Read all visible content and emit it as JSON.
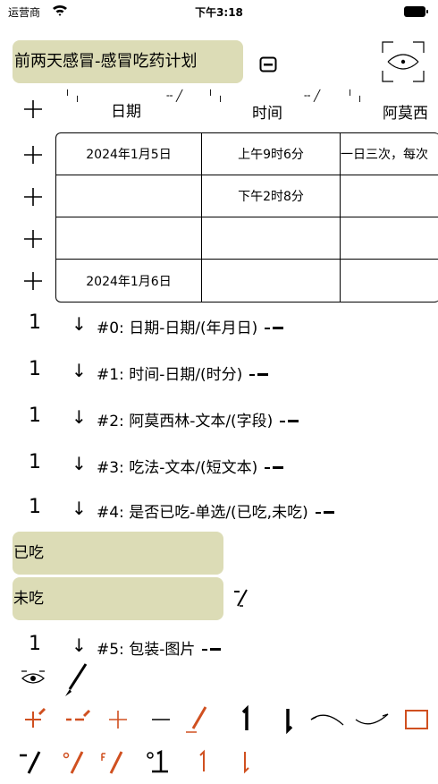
{
  "status_bar": {
    "carrier": "运营商",
    "time": "下午3:18"
  },
  "title": "前两天感冒-感冒吃药计划",
  "table": {
    "headers": [
      "日期",
      "时间",
      "阿莫西"
    ],
    "rows": [
      [
        "2024年1月5日",
        "上午9时6分",
        "一日三次，每次"
      ],
      [
        "",
        "下午2时8分",
        ""
      ],
      [
        "",
        "",
        ""
      ],
      [
        "2024年1月6日",
        "",
        ""
      ]
    ]
  },
  "fields": [
    "#0:  日期-日期/(年月日)",
    "#1:  时间-日期/(时分)",
    "#2:  阿莫西林-文本/(字段)",
    "#3:  吃法-文本/(短文本)",
    "#4:  是否已吃-单选/(已吃,未吃)"
  ],
  "options": [
    "已吃",
    "未吃"
  ],
  "field5": "#5:  包装-图片",
  "tick_glyphs": {
    "up": "1",
    "down": "↓"
  },
  "colors": {
    "accent": "#d05020",
    "option_bg": "#dcdcb6"
  },
  "icons": [
    "wifi-icon",
    "battery-icon",
    "note-icon",
    "scan-icon",
    "plus-icon",
    "eye-icon",
    "brush-icon",
    "curve-icon",
    "square-icon"
  ]
}
